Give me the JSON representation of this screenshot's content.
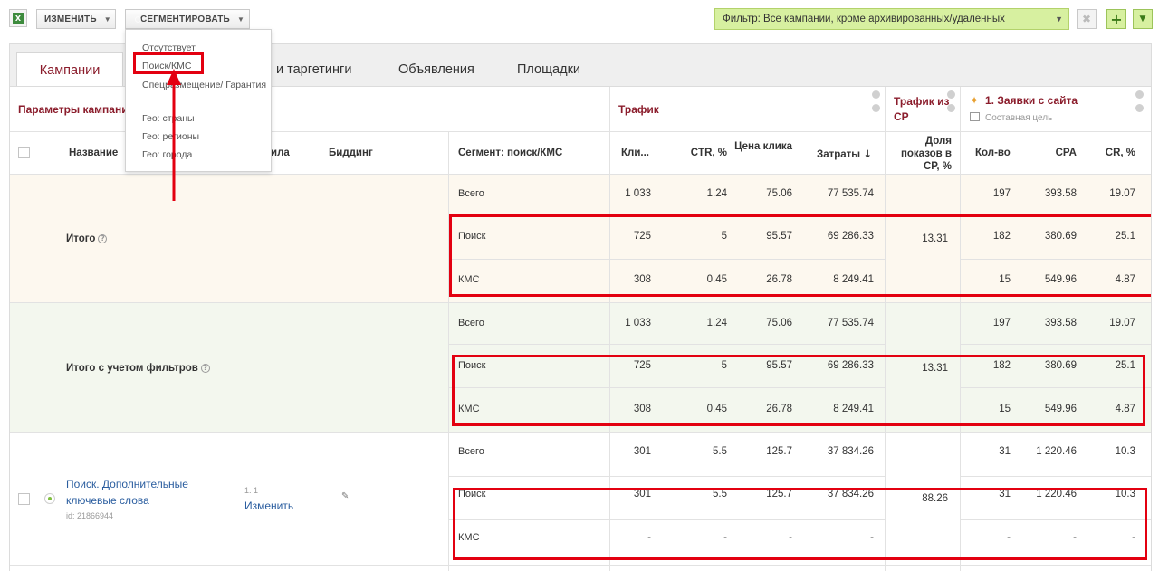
{
  "toolbar": {
    "change_label": "ИЗМЕНИТЬ",
    "segment_label": "СЕГМЕНТИРОВАТЬ",
    "filter_text": "Фильтр: Все кампании, кроме архивированных/удаленных",
    "excel_icon": "excel-icon"
  },
  "dropdown": {
    "items": [
      "Отсутствует",
      "Поиск/КМС",
      "Спецразмещение/ Гарантия",
      "Гео: страны",
      "Гео: регионы",
      "Гео: города"
    ]
  },
  "tabs": [
    "Кампании",
    "и таргетинги",
    "Объявления",
    "Площадки"
  ],
  "header": {
    "group_params": "Параметры кампании",
    "group_traffic": "Трафик",
    "group_sr": "Трафик из СР",
    "group_goal": "1. Заявки с сайта",
    "goal_sub": "Составная цель",
    "col_name": "Название",
    "col_rule": "ила",
    "col_bidding": "Биддинг",
    "col_segment": "Сегмент: поиск/КМС",
    "col_clicks": "Кли...",
    "col_ctr": "CTR, %",
    "col_price": "Цена клика",
    "col_cost": "Затраты",
    "col_share": "Доля показов в СР, %",
    "col_count": "Кол-во",
    "col_cpa": "CPA",
    "col_cr": "CR, %"
  },
  "sections": [
    {
      "title": "Итого",
      "share": "13.31",
      "rows": [
        {
          "seg": "Всего",
          "clicks": "1 033",
          "ctr": "1.24",
          "price": "75.06",
          "cost": "77 535.74",
          "count": "197",
          "cpa": "393.58",
          "cr": "19.07"
        },
        {
          "seg": "Поиск",
          "clicks": "725",
          "ctr": "5",
          "price": "95.57",
          "cost": "69 286.33",
          "count": "182",
          "cpa": "380.69",
          "cr": "25.1"
        },
        {
          "seg": "КМС",
          "clicks": "308",
          "ctr": "0.45",
          "price": "26.78",
          "cost": "8 249.41",
          "count": "15",
          "cpa": "549.96",
          "cr": "4.87"
        }
      ]
    },
    {
      "title": "Итого с учетом фильтров",
      "share": "13.31",
      "rows": [
        {
          "seg": "Всего",
          "clicks": "1 033",
          "ctr": "1.24",
          "price": "75.06",
          "cost": "77 535.74",
          "count": "197",
          "cpa": "393.58",
          "cr": "19.07"
        },
        {
          "seg": "Поиск",
          "clicks": "725",
          "ctr": "5",
          "price": "95.57",
          "cost": "69 286.33",
          "count": "182",
          "cpa": "380.69",
          "cr": "25.1"
        },
        {
          "seg": "КМС",
          "clicks": "308",
          "ctr": "0.45",
          "price": "26.78",
          "cost": "8 249.41",
          "count": "15",
          "cpa": "549.96",
          "cr": "4.87"
        }
      ]
    },
    {
      "title": "Поиск. Дополнительные ключевые слова",
      "campaign_id": "id: 21866944",
      "rule_num": "1. 1",
      "rule_link": "Изменить",
      "share": "88.26",
      "rows": [
        {
          "seg": "Всего",
          "clicks": "301",
          "ctr": "5.5",
          "price": "125.7",
          "cost": "37 834.26",
          "count": "31",
          "cpa": "1 220.46",
          "cr": "10.3"
        },
        {
          "seg": "Поиск",
          "clicks": "301",
          "ctr": "5.5",
          "price": "125.7",
          "cost": "37 834.26",
          "count": "31",
          "cpa": "1 220.46",
          "cr": "10.3"
        },
        {
          "seg": "КМС",
          "clicks": "-",
          "ctr": "-",
          "price": "-",
          "cost": "-",
          "count": "-",
          "cpa": "-",
          "cr": "-"
        }
      ]
    }
  ]
}
